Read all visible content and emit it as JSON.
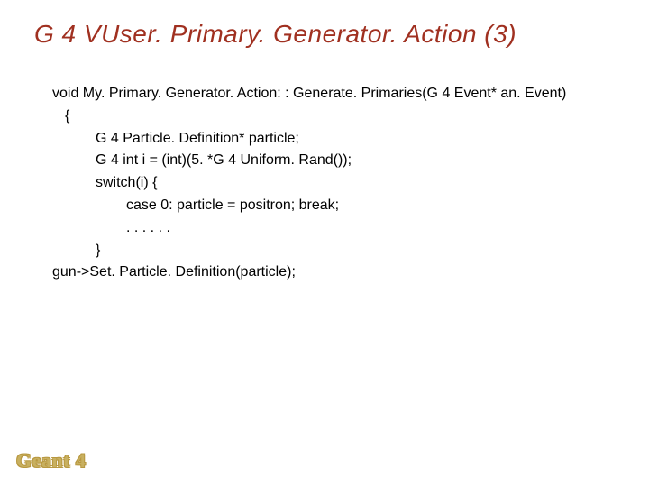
{
  "title": "G 4 VUser. Primary. Generator. Action (3)",
  "code": {
    "l1": "void My. Primary. Generator. Action: : Generate. Primaries(G 4 Event* an. Event)",
    "l2": "{",
    "l3": "G 4 Particle. Definition* particle;",
    "l4": "G 4 int i = (int)(5. *G 4 Uniform. Rand());",
    "l5": "switch(i) {",
    "l6": "case 0: particle = positron; break;",
    "l7": ". . . . . .",
    "l8": "}",
    "l9": "gun->Set. Particle. Definition(particle);"
  },
  "footer": "Geant 4"
}
